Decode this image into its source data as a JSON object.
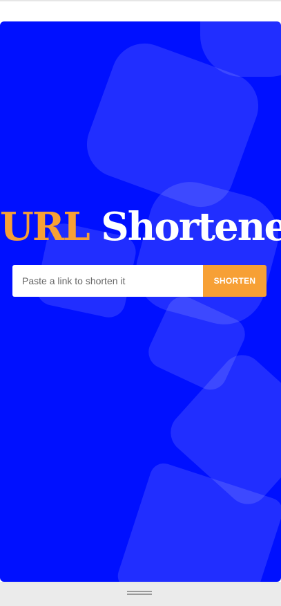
{
  "hero": {
    "title_accent": "URL",
    "title_main": "Shortener"
  },
  "form": {
    "placeholder": "Paste a link to shorten it",
    "button_label": "SHORTEN"
  },
  "colors": {
    "background": "#0010ff",
    "accent": "#f7a035",
    "text_light": "#ffffff"
  },
  "icons": [
    "resize-handle-icon"
  ]
}
